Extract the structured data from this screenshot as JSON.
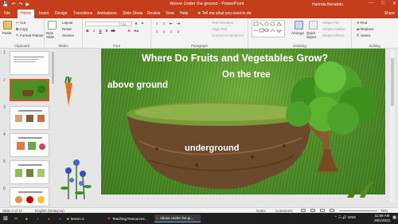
{
  "window": {
    "title": "Above Under the ground - PowerPoint",
    "user": "Harinda Benabdu",
    "qa_icons": [
      "save-icon",
      "undo-icon",
      "redo-icon",
      "slideshow-icon"
    ]
  },
  "ribbon": {
    "tabs": [
      "File",
      "Home",
      "Insert",
      "Design",
      "Transitions",
      "Animations",
      "Slide Show",
      "Review",
      "View",
      "Help"
    ],
    "active_tab": "Home",
    "tell_me": "Tell me what you want to do",
    "share": "Share",
    "clipboard": {
      "paste": "Paste",
      "cut": "Cut",
      "copy": "Copy",
      "format_painter": "Format Painter",
      "label": "Clipboard"
    },
    "slides": {
      "new_slide": "New Slide",
      "layout": "Layout",
      "reset": "Reset",
      "section": "Section",
      "label": "Slides"
    },
    "font": {
      "size": "20",
      "label": "Font"
    },
    "paragraph": {
      "text_direction": "Text Direction",
      "align_text": "Align Text",
      "convert_smartart": "Convert to SmartArt",
      "label": "Paragraph"
    },
    "drawing": {
      "arrange": "Arrange",
      "quick_styles": "Quick Styles",
      "shape_fill": "Shape Fill",
      "shape_outline": "Shape Outline",
      "shape_effects": "Shape Effects",
      "label": "Drawing"
    },
    "editing": {
      "find": "Find",
      "replace": "Replace",
      "select": "Select",
      "label": "Editing"
    }
  },
  "thumbnails": [
    {
      "num": "1"
    },
    {
      "num": "2"
    },
    {
      "num": "3"
    },
    {
      "num": "4"
    },
    {
      "num": "5"
    },
    {
      "num": "6"
    }
  ],
  "slide": {
    "title": "Where Do Fruits and Vegetables Grow?",
    "above_ground": "above ground",
    "on_the_tree": "On the tree",
    "underground": "underground"
  },
  "statusbar": {
    "slide_info": "Slide 2 of 12",
    "language": "English (Malaysia)",
    "notes": "Notes",
    "comments": "Comments",
    "zoom": "79%"
  },
  "taskbar": {
    "items": [
      "lesson 2",
      "Teaching Resources...",
      "Above Under the gr..."
    ],
    "lang": "ENG",
    "time": "11:58 AM",
    "date": "28/1/2022"
  }
}
